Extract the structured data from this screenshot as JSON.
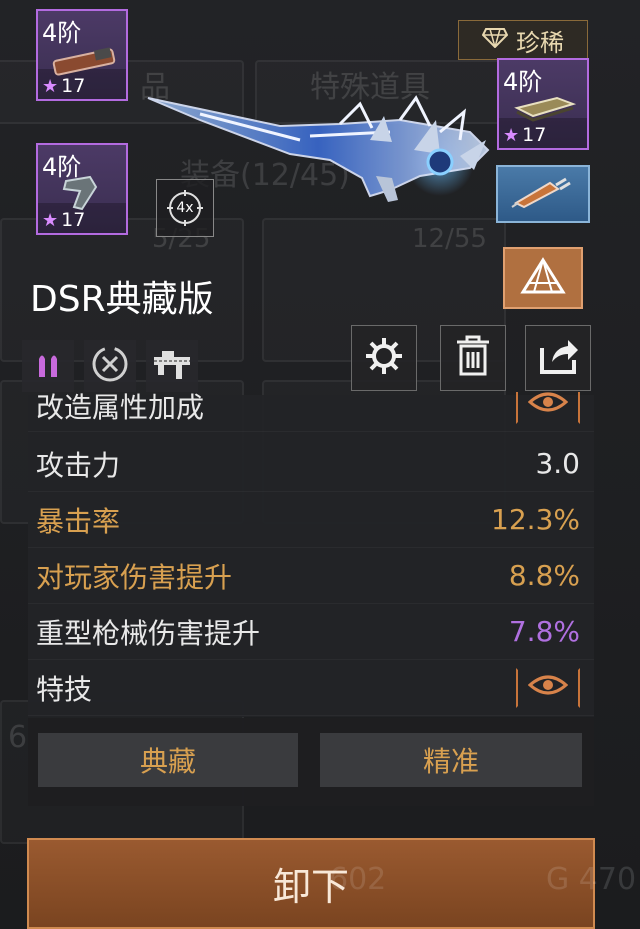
{
  "rarity": {
    "label": "珍稀"
  },
  "background": {
    "tab1": "品",
    "tab2": "特殊道具",
    "equip_count": "装备(12/45)",
    "card1_count": "5/25",
    "card2_count": "12/55",
    "bottom_left": "6",
    "bottom_mid": "602",
    "bottom_right": "G 470"
  },
  "slots": [
    {
      "tier": "4阶",
      "level": "17",
      "item": "stock-icon"
    },
    {
      "tier": "4阶",
      "level": "17",
      "item": "magazine-icon"
    },
    {
      "tier": "4阶",
      "level": "17",
      "item": "grip-icon"
    },
    {
      "item": "syringe-icon"
    }
  ],
  "scope": {
    "label": "4x"
  },
  "weapon": {
    "name": "DSR典藏版"
  },
  "actions": [
    "settings-gear-icon",
    "trash-icon",
    "share-icon"
  ],
  "stats": {
    "header": "改造属性加成",
    "rows": [
      {
        "label": "攻击力",
        "value": "3.0",
        "color": "#e8e8e8"
      },
      {
        "label": "暴击率",
        "value": "12.3%",
        "color": "#d8a050"
      },
      {
        "label": "对玩家伤害提升",
        "value": "8.8%",
        "color": "#d8a050"
      },
      {
        "label": "重型枪械伤害提升",
        "value": "7.8%",
        "color": "#b070e0"
      }
    ]
  },
  "skills": {
    "label": "特技",
    "tags": [
      "典藏",
      "精准"
    ]
  },
  "unequip": {
    "label": "卸下"
  },
  "colors": {
    "accent_orange": "#c8743a",
    "purple_border": "#b36be0",
    "gold_text": "#d8a050",
    "purple_text": "#b070e0"
  }
}
